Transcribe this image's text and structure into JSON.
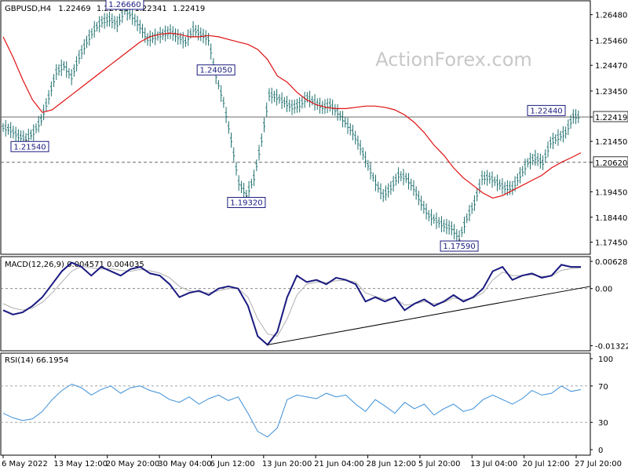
{
  "header": {
    "symbol": "GBPUSD,H4",
    "open": "1.22469",
    "high": "1.22721",
    "low": "1.22341",
    "close": "1.22419"
  },
  "watermark": "ActionForex.com",
  "colors": {
    "background": "#ffffff",
    "price_bars": "#1f6f6f",
    "moving_average": "#e01010",
    "macd_main": "#1a1a80",
    "macd_signal": "#b0b0b0",
    "rsi_line": "#3b8fd8",
    "trendline": "#000000",
    "axis": "#000000",
    "level_labels": "#1a1a80"
  },
  "x_axis_labels": [
    "6 May 2022",
    "13 May 12:00",
    "20 May 20:00",
    "30 May 04:00",
    "6 Jun 12:00",
    "13 Jun 20:00",
    "21 Jun 04:00",
    "28 Jun 12:00",
    "5 Jul 20:00",
    "13 Jul 04:00",
    "20 Jul 12:00",
    "27 Jul 20:00"
  ],
  "chart_data": [
    {
      "type": "ohlc",
      "title": "GBPUSD,H4",
      "ylim": [
        1.17,
        1.27
      ],
      "y_ticks": [
        "1.26480",
        "1.25460",
        "1.24470",
        "1.23450",
        "1.22419",
        "1.21450",
        "1.20620",
        "1.19450",
        "1.18440",
        "1.17450"
      ],
      "close_series": [
        1.22,
        1.219,
        1.2165,
        1.2154,
        1.218,
        1.223,
        1.232,
        1.242,
        1.2445,
        1.24,
        1.248,
        1.254,
        1.259,
        1.262,
        1.263,
        1.261,
        1.2666,
        1.264,
        1.26,
        1.255,
        1.256,
        1.257,
        1.258,
        1.256,
        1.254,
        1.259,
        1.257,
        1.255,
        1.2405,
        1.23,
        1.215,
        1.198,
        1.1932,
        1.2,
        1.215,
        1.233,
        1.232,
        1.23,
        1.228,
        1.229,
        1.232,
        1.23,
        1.228,
        1.229,
        1.226,
        1.222,
        1.218,
        1.212,
        1.205,
        1.198,
        1.193,
        1.196,
        1.201,
        1.2,
        1.196,
        1.19,
        1.185,
        1.183,
        1.181,
        1.18,
        1.1759,
        1.184,
        1.19,
        1.2,
        1.2,
        1.198,
        1.196,
        1.196,
        1.201,
        1.206,
        1.208,
        1.206,
        1.214,
        1.216,
        1.218,
        1.2244,
        1.2242
      ],
      "moving_average": [
        1.256,
        1.248,
        1.239,
        1.231,
        1.226,
        1.227,
        1.23,
        1.233,
        1.236,
        1.239,
        1.242,
        1.245,
        1.248,
        1.251,
        1.254,
        1.256,
        1.257,
        1.2575,
        1.257,
        1.256,
        1.256,
        1.2565,
        1.256,
        1.255,
        1.254,
        1.253,
        1.251,
        1.247,
        1.2405,
        1.238,
        1.234,
        1.231,
        1.229,
        1.228,
        1.2275,
        1.2275,
        1.228,
        1.2285,
        1.2285,
        1.228,
        1.227,
        1.225,
        1.222,
        1.218,
        1.213,
        1.209,
        1.204,
        1.2,
        1.197,
        1.194,
        1.192,
        1.193,
        1.195,
        1.197,
        1.199,
        1.201,
        1.204,
        1.2062,
        1.208,
        1.21
      ],
      "horizontal_levels": [
        {
          "value": 1.22419,
          "label": "1.22419",
          "style": "solid"
        },
        {
          "value": 1.2062,
          "label": "1.20620",
          "style": "dashed"
        }
      ],
      "annotations": [
        {
          "label": "1.26660",
          "index": 16,
          "value": 1.2666
        },
        {
          "label": "1.21540",
          "index": 3,
          "value": 1.2154
        },
        {
          "label": "1.24050",
          "index": 28,
          "value": 1.2405
        },
        {
          "label": "1.19320",
          "index": 32,
          "value": 1.1932
        },
        {
          "label": "1.17590",
          "index": 60,
          "value": 1.1759
        },
        {
          "label": "1.22440",
          "index": 75,
          "value": 1.2244
        }
      ],
      "current_price_label": "1.22419"
    },
    {
      "type": "line",
      "title": "MACD(12,26,9) 0.004571 0.004035",
      "ylim": [
        -0.0142,
        0.0072
      ],
      "y_ticks": [
        "0.006285",
        "0.00",
        "-0.013223"
      ],
      "series": [
        {
          "name": "MACD",
          "values": [
            -0.005,
            -0.006,
            -0.0055,
            -0.004,
            -0.002,
            0.001,
            0.004,
            0.006,
            0.005,
            0.003,
            0.005,
            0.004,
            0.003,
            0.0045,
            0.005,
            0.0035,
            0.003,
            0.001,
            -0.002,
            -0.001,
            -0.0005,
            -0.0015,
            0.0,
            0.0005,
            0.0,
            -0.004,
            -0.011,
            -0.013,
            -0.01,
            -0.002,
            0.003,
            0.0015,
            0.002,
            0.001,
            0.0025,
            0.002,
            0.001,
            -0.003,
            -0.002,
            -0.003,
            -0.002,
            -0.005,
            -0.0035,
            -0.0025,
            -0.004,
            -0.003,
            -0.0015,
            -0.003,
            -0.002,
            0.0,
            0.004,
            0.005,
            0.002,
            0.003,
            0.0035,
            0.0025,
            0.003,
            0.0055,
            0.005,
            0.005
          ]
        },
        {
          "name": "Signal",
          "values": [
            -0.0035,
            -0.0045,
            -0.005,
            -0.0045,
            -0.0032,
            -0.001,
            0.0015,
            0.004,
            0.0052,
            0.0048,
            0.0045,
            0.0046,
            0.0042,
            0.004,
            0.0044,
            0.0041,
            0.0036,
            0.0025,
            0.0005,
            -0.0005,
            -0.0008,
            -0.001,
            -0.0005,
            0.0,
            0.0,
            -0.002,
            -0.007,
            -0.0105,
            -0.011,
            -0.007,
            -0.0015,
            0.001,
            0.0015,
            0.0014,
            0.0018,
            0.0019,
            0.0015,
            -0.001,
            -0.0018,
            -0.0025,
            -0.0022,
            -0.0038,
            -0.0036,
            -0.003,
            -0.0035,
            -0.0032,
            -0.0022,
            -0.0026,
            -0.0022,
            -0.001,
            0.002,
            0.0038,
            0.003,
            0.003,
            0.0032,
            0.0028,
            0.0029,
            0.0042,
            0.0046,
            0.0048
          ]
        }
      ],
      "trendline": {
        "from": {
          "index": 27,
          "value": -0.013
        },
        "to": {
          "index": 59,
          "value": 0.0005
        }
      }
    },
    {
      "type": "line",
      "title": "RSI(14) 66.1954",
      "ylim": [
        0,
        100
      ],
      "y_ticks": [
        "100",
        "70",
        "30",
        "0"
      ],
      "reference_levels": [
        70,
        30
      ],
      "series": [
        {
          "name": "RSI",
          "values": [
            40,
            35,
            32,
            34,
            42,
            55,
            65,
            72,
            68,
            60,
            66,
            70,
            62,
            68,
            70,
            65,
            62,
            55,
            52,
            58,
            50,
            56,
            60,
            54,
            58,
            40,
            20,
            14,
            24,
            55,
            60,
            58,
            56,
            62,
            58,
            60,
            50,
            42,
            55,
            48,
            40,
            52,
            45,
            50,
            38,
            45,
            50,
            42,
            45,
            55,
            60,
            55,
            50,
            56,
            65,
            60,
            62,
            70,
            64,
            66
          ]
        }
      ]
    }
  ]
}
